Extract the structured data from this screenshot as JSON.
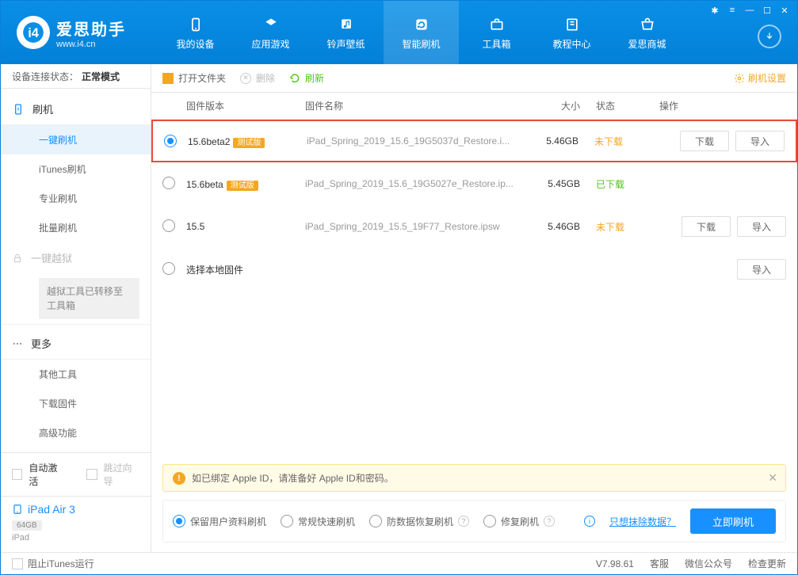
{
  "app": {
    "title": "爱思助手",
    "url": "www.i4.cn"
  },
  "nav": [
    {
      "label": "我的设备",
      "id": "device"
    },
    {
      "label": "应用游戏",
      "id": "apps"
    },
    {
      "label": "铃声壁纸",
      "id": "ringtones"
    },
    {
      "label": "智能刷机",
      "id": "flash",
      "active": true
    },
    {
      "label": "工具箱",
      "id": "toolbox"
    },
    {
      "label": "教程中心",
      "id": "tutorials"
    },
    {
      "label": "爱思商城",
      "id": "store"
    }
  ],
  "sidebar": {
    "status_label": "设备连接状态：",
    "status_value": "正常模式",
    "flash_head": "刷机",
    "items": [
      {
        "label": "一键刷机",
        "active": true
      },
      {
        "label": "iTunes刷机"
      },
      {
        "label": "专业刷机"
      },
      {
        "label": "批量刷机"
      }
    ],
    "jailbreak_head": "一键越狱",
    "jailbreak_note": "越狱工具已转移至工具箱",
    "more_head": "更多",
    "more_items": [
      {
        "label": "其他工具"
      },
      {
        "label": "下载固件"
      },
      {
        "label": "高级功能"
      }
    ],
    "auto_activate": "自动激活",
    "skip_guide": "跳过向导",
    "device_name": "iPad Air 3",
    "device_storage": "64GB",
    "device_type": "iPad"
  },
  "toolbar": {
    "open_folder": "打开文件夹",
    "delete": "删除",
    "refresh": "刷新",
    "settings": "刷机设置"
  },
  "table": {
    "headers": {
      "version": "固件版本",
      "name": "固件名称",
      "size": "大小",
      "status": "状态",
      "action": "操作"
    },
    "rows": [
      {
        "selected": true,
        "highlighted": true,
        "version": "15.6beta2",
        "beta": "测试版",
        "name": "iPad_Spring_2019_15.6_19G5037d_Restore.i...",
        "size": "5.46GB",
        "status": "未下载",
        "status_class": "not",
        "download": "下载",
        "import": "导入"
      },
      {
        "version": "15.6beta",
        "beta": "测试版",
        "name": "iPad_Spring_2019_15.6_19G5027e_Restore.ip...",
        "size": "5.45GB",
        "status": "已下载",
        "status_class": "done"
      },
      {
        "version": "15.5",
        "name": "iPad_Spring_2019_15.5_19F77_Restore.ipsw",
        "size": "5.46GB",
        "status": "未下载",
        "status_class": "not",
        "download": "下载",
        "import": "导入"
      },
      {
        "local": true,
        "name": "选择本地固件",
        "import": "导入"
      }
    ]
  },
  "notice": "如已绑定 Apple ID，请准备好 Apple ID和密码。",
  "flash_opts": {
    "keep_data": "保留用户资料刷机",
    "normal": "常规快速刷机",
    "anti_recovery": "防数据恢复刷机",
    "repair": "修复刷机",
    "erase_link": "只想抹除数据？",
    "flash_btn": "立即刷机"
  },
  "footer": {
    "block_itunes": "阻止iTunes运行",
    "version": "V7.98.61",
    "service": "客服",
    "wechat": "微信公众号",
    "update": "检查更新"
  }
}
